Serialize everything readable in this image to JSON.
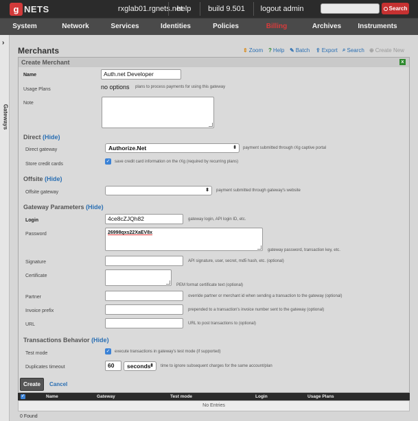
{
  "topbar": {
    "logo_letter": "g",
    "logo_text": "NETS",
    "hostname": "rxglab01.rgnets.net",
    "help": "help",
    "build": "build 9.501",
    "logout": "logout admin",
    "search_placeholder": "",
    "search_button": "Search"
  },
  "menu": [
    "System",
    "Network",
    "Services",
    "Identities",
    "Policies",
    "Billing",
    "Archives",
    "Instruments"
  ],
  "rail": {
    "chevron": "›",
    "label": "Gateways"
  },
  "page": {
    "title": "Merchants",
    "tools": {
      "zoom": "Zoom",
      "help": "Help",
      "batch": "Batch",
      "export": "Export",
      "search": "Search",
      "create_new": "Create New"
    }
  },
  "form": {
    "title": "Create Merchant",
    "close": "x",
    "name_label": "Name",
    "name_value": "Auth.net Developer",
    "usage_plans_label": "Usage Plans",
    "usage_plans_value": "no options",
    "usage_plans_hint": "plans to process payments for using this gateway",
    "note_label": "Note",
    "direct": {
      "section": "Direct",
      "toggle": "(Hide)",
      "gateway_label": "Direct gateway",
      "gateway_value": "Authorize.Net",
      "gateway_hint": "payment submitted through rXg captive portal",
      "store_label": "Store credit cards",
      "store_hint": "save credit card information on the rXg (required by recurring plans)"
    },
    "offsite": {
      "section": "Offsite",
      "toggle": "(Hide)",
      "gateway_label": "Offsite gateway",
      "gateway_value": "",
      "gateway_hint": "payment submitted through gateway's website"
    },
    "params": {
      "section": "Gateway Parameters",
      "toggle": "(Hide)",
      "login_label": "Login",
      "login_value": "4ce8cZJQh82",
      "login_hint": "gateway login, API login ID, etc.",
      "password_label": "Password",
      "password_value": "26998qxs22XaEV8x",
      "password_hint": "gateway password, transaction key, etc.",
      "signature_label": "Signature",
      "signature_hint": "API signature, user, secret, md5 hash, etc. (optional)",
      "certificate_label": "Certificate",
      "certificate_hint": "PEM format certificate text (optional)",
      "partner_label": "Partner",
      "partner_hint": "override partner or merchant id when sending a transaction to the gateway (optional)",
      "invoice_label": "Invoice prefix",
      "invoice_hint": "prepended to a transaction's invoice number sent to the gateway (optional)",
      "url_label": "URL",
      "url_hint": "URL to post transactions to (optional)"
    },
    "transactions": {
      "section": "Transactions Behavior",
      "toggle": "(Hide)",
      "test_label": "Test mode",
      "test_hint": "execute transactions in gateway's test mode (if supported)",
      "dup_label": "Duplicates timeout",
      "dup_value": "60",
      "dup_unit": "seconds",
      "dup_hint": "time to ignore subsequent charges for the same account/plan"
    },
    "create_button": "Create",
    "cancel_link": "Cancel"
  },
  "table": {
    "columns": [
      "Name",
      "Gateway",
      "Test mode",
      "Login",
      "Usage Plans"
    ],
    "empty": "No Entries",
    "found": "0 Found"
  }
}
